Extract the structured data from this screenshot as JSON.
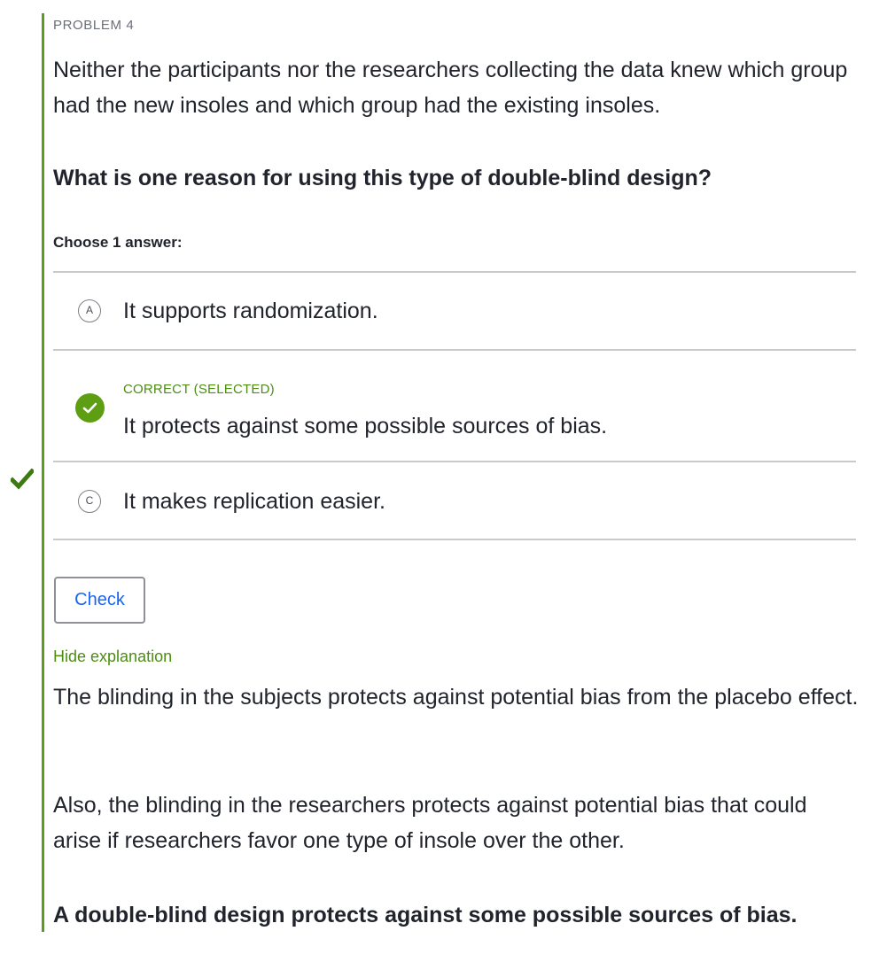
{
  "problem": {
    "label": "PROBLEM 4",
    "stem": "Neither the participants nor the researchers collecting the data knew which group had the new insoles and which group had the existing insoles.",
    "question": "What is one reason for using this type of double-blind design?",
    "choose_label": "Choose 1 answer:"
  },
  "choices": [
    {
      "letter": "A",
      "text": "It supports randomization.",
      "state": "unselected"
    },
    {
      "letter": "B",
      "text": "It protects against some possible sources of bias.",
      "state": "correct-selected",
      "status_label": "CORRECT (SELECTED)"
    },
    {
      "letter": "C",
      "text": "It makes replication easier.",
      "state": "unselected"
    }
  ],
  "buttons": {
    "check_label": "Check"
  },
  "explanation": {
    "toggle_label": "Hide explanation",
    "paragraphs": [
      "The blinding in the subjects protects against potential bias from the placebo effect.",
      "Also, the blinding in the researchers protects against potential bias that could arise if researchers favor one type of insole over the other."
    ],
    "conclusion": "A double-blind design protects against some possible sources of bias."
  },
  "colors": {
    "accent_green": "#5b9c1c",
    "correct_green": "#4c8d12",
    "link_blue": "#1865f2",
    "text": "#21242c",
    "divider": "#c9cacc"
  },
  "icons": {
    "status": "checkmark-icon",
    "correct_choice": "check-circle-icon"
  }
}
